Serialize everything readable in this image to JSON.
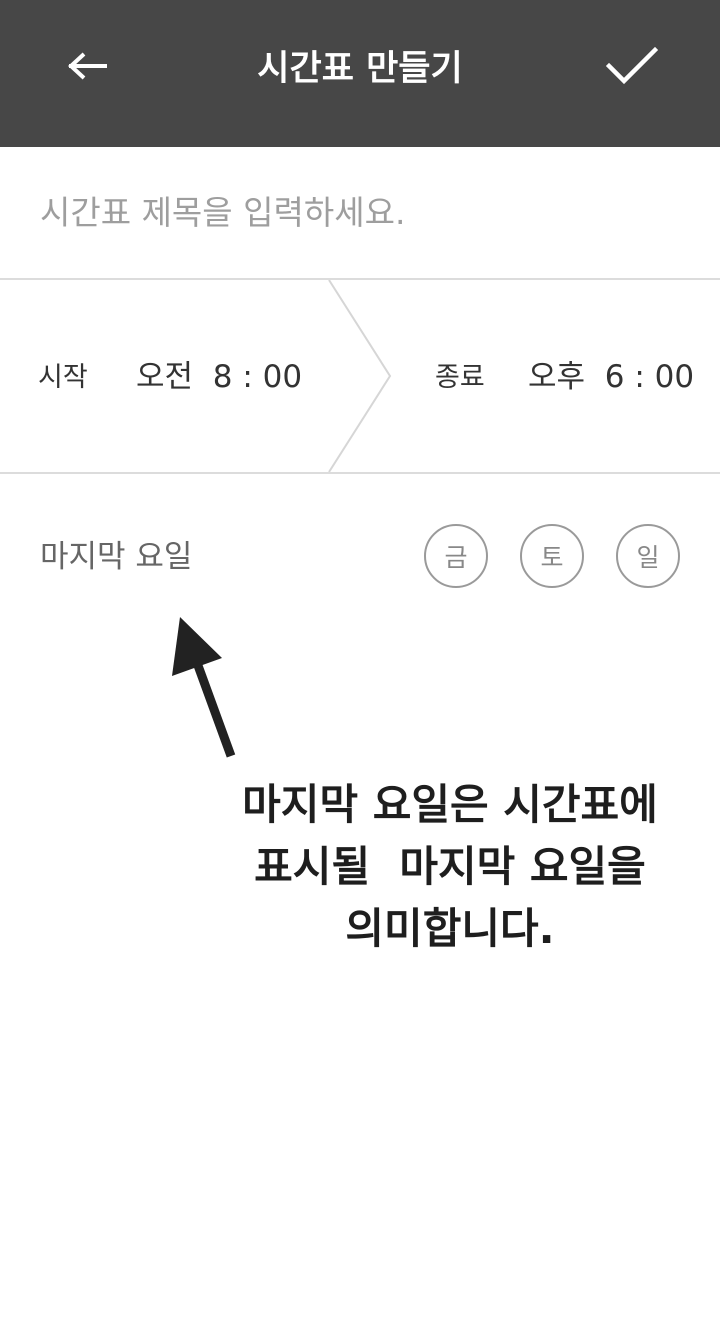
{
  "appbar": {
    "title": "시간표 만들기",
    "back_icon": "arrow-left-icon",
    "confirm_icon": "check-icon",
    "background": "#474747"
  },
  "title_input": {
    "placeholder": "시간표 제목을 입력하세요.",
    "value": ""
  },
  "time_range": {
    "start": {
      "label": "시작",
      "value": "오전  8 : 00"
    },
    "end": {
      "label": "종료",
      "value": "오후  6 : 00"
    },
    "separator_icon": "chevron-right-icon"
  },
  "last_day": {
    "label": "마지막 요일",
    "options": [
      "금",
      "토",
      "일"
    ]
  },
  "annotation": {
    "arrow_icon": "arrow-up-icon",
    "lines": [
      "마지막 요일은 시간표에",
      "표시될  마지막 요일을",
      "의미합니다."
    ]
  }
}
